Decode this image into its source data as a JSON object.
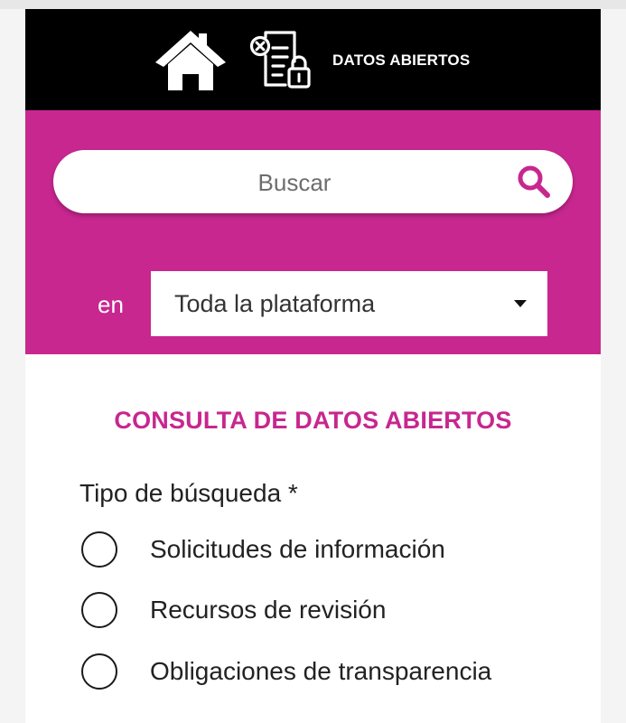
{
  "header": {
    "home_icon": "home-icon",
    "open_data_icon": "document-lock-icon",
    "nav_label": "DATOS ABIERTOS"
  },
  "search": {
    "placeholder": "Buscar",
    "icon": "search-icon",
    "scope_label": "en",
    "scope_selected": "Toda la plataforma"
  },
  "form": {
    "title": "CONSULTA DE DATOS ABIERTOS",
    "search_type_label": "Tipo de búsqueda *",
    "options": [
      {
        "label": "Solicitudes de información",
        "selected": false
      },
      {
        "label": "Recursos de revisión",
        "selected": false
      },
      {
        "label": "Obligaciones de transparencia",
        "selected": false
      }
    ]
  },
  "colors": {
    "brand_magenta": "#c7278f",
    "header_black": "#000000",
    "text_dark": "#222222"
  }
}
